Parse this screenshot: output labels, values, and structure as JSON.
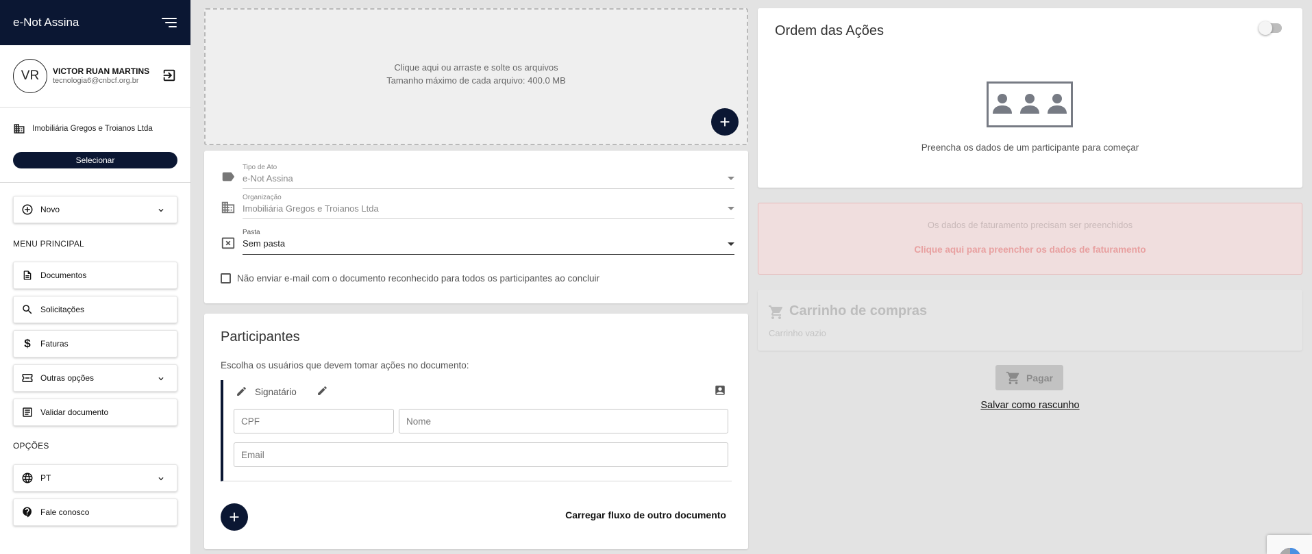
{
  "sidebar": {
    "app_title": "e-Not Assina",
    "user": {
      "initials": "VR",
      "name": "VICTOR RUAN MARTINS",
      "email": "tecnologia6@cnbcf.org.br"
    },
    "org_name": "Imobiliária Gregos e Troianos Ltda",
    "select_label": "Selecionar",
    "novo_label": "Novo",
    "main_menu_label": "MENU PRINCIPAL",
    "items": [
      {
        "label": "Documentos",
        "icon": "document-icon"
      },
      {
        "label": "Solicitações",
        "icon": "search-icon"
      },
      {
        "label": "Faturas",
        "icon": "dollar-icon"
      },
      {
        "label": "Outras opções",
        "icon": "ticket-icon"
      },
      {
        "label": "Validar documento",
        "icon": "receipt-icon"
      }
    ],
    "options_label": "OPÇÕES",
    "language_label": "PT",
    "contact_label": "Fale conosco"
  },
  "upload": {
    "line1": "Clique aqui ou arraste e solte os arquivos",
    "line2": "Tamanho máximo de cada arquivo: 400.0 MB"
  },
  "form": {
    "tipo_label": "Tipo de Ato",
    "tipo_value": "e-Not Assina",
    "org_label": "Organização",
    "org_value": "Imobiliária Gregos e Troianos Ltda",
    "pasta_label": "Pasta",
    "pasta_value": "Sem pasta",
    "no_email_label": "Não enviar e-mail com o documento reconhecido para todos os participantes ao concluir"
  },
  "participants": {
    "title": "Participantes",
    "subtitle": "Escolha os usuários que devem tomar ações no documento:",
    "role": "Signatário",
    "cpf_placeholder": "CPF",
    "name_placeholder": "Nome",
    "email_placeholder": "Email",
    "load_flow": "Carregar fluxo de outro documento"
  },
  "actions_order": {
    "title": "Ordem das Ações",
    "empty_text": "Preencha os dados de um participante para começar"
  },
  "billing": {
    "warning": "Os dados de faturamento precisam ser preenchidos",
    "link": "Clique aqui para preencher os dados de faturamento"
  },
  "cart": {
    "title": "Carrinho de compras",
    "empty": "Carrinho vazio",
    "pay_label": "Pagar",
    "save_draft": "Salvar como rascunho"
  },
  "colors": {
    "navy": "#0b1733",
    "billing_text": "#e8a0a0",
    "billing_bg": "#f0dede"
  }
}
